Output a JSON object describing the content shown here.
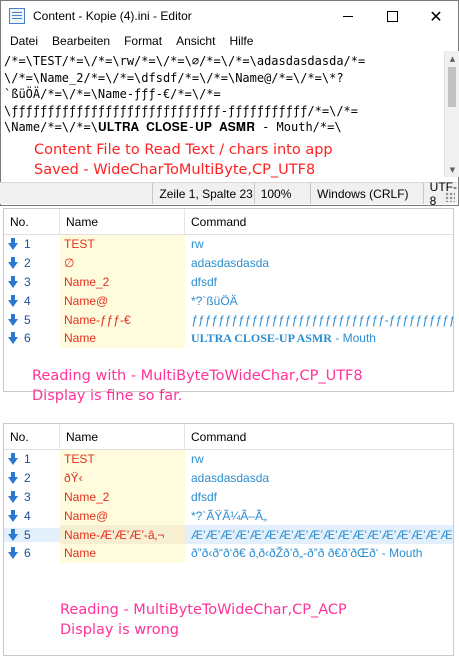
{
  "window": {
    "title": "Content - Kopie (4).ini - Editor",
    "minimize": "",
    "maximize": "",
    "close": "✕"
  },
  "menu": [
    "Datei",
    "Bearbeiten",
    "Format",
    "Ansicht",
    "Hilfe"
  ],
  "editor_lines": [
    "/*=\\TEST/*=\\/*=\\rw/*=\\/*=\\∅/*=\\/*=\\adasdasdasda/*=",
    "\\/*=\\Name_2/*=\\/*=\\dfsdf/*=\\/*=\\Name@/*=\\/*=\\*?",
    "`ßüÖÄ/*=\\/*=\\Name-ƒƒƒ-€/*=\\/*=",
    "\\ƒƒƒƒƒƒƒƒƒƒƒƒƒƒƒƒƒƒƒƒƒƒƒƒƒƒƒƒƒ-ƒƒƒƒƒƒƒƒƒƒƒ/*=\\/*=",
    "\\Name/*=\\/*=\\𝐔𝐋𝐓𝐑𝐀 𝐂𝐋𝐎𝐒𝐄-𝐔𝐏 𝐀𝐒𝐌𝐑 - Mouth/*=\\"
  ],
  "status": {
    "position": "Zeile 1, Spalte 23",
    "zoom": "100%",
    "line_ending": "Windows (CRLF)",
    "encoding": "UTF-8"
  },
  "annotations": {
    "a1_line1": "Content File to Read Text / chars into app",
    "a1_line2": "Saved - WideCharToMultiByte,CP_UTF8",
    "a2_line1": "Reading with - MultiByteToWideChar,CP_UTF8",
    "a2_line2": "Display is fine so far.",
    "a3_line1": "Reading - MultiByteToWideChar,CP_ACP",
    "a3_line2": "Display is wrong"
  },
  "columns": {
    "no": "No.",
    "name": "Name",
    "command": "Command"
  },
  "list_utf8": [
    {
      "no": "1",
      "name": "TEST",
      "command": "rw"
    },
    {
      "no": "2",
      "name": "∅",
      "command": "adasdasdasda"
    },
    {
      "no": "3",
      "name": "Name_2",
      "command": "dfsdf"
    },
    {
      "no": "4",
      "name": "Name@",
      "command": "*?`ßüÖÄ"
    },
    {
      "no": "5",
      "name": "Name-ƒƒƒ-€",
      "command": "ƒƒƒƒƒƒƒƒƒƒƒƒƒƒƒƒƒƒƒƒƒƒƒƒƒƒƒƒƒ-ƒƒƒƒƒƒƒƒƒƒƒ"
    },
    {
      "no": "6",
      "name": "Name",
      "command_bold": "ULTRA CLOSE-UP ASMR",
      "command_rest": " - Mouth"
    }
  ],
  "list_acp": [
    {
      "no": "1",
      "name": "TEST",
      "command": "rw"
    },
    {
      "no": "2",
      "name": "ðŸ‹",
      "command": "adasdasdasda"
    },
    {
      "no": "3",
      "name": "Name_2",
      "command": "dfsdf"
    },
    {
      "no": "4",
      "name": "Name@",
      "command": "*?`ÃŸÃ¼Ã–Ã„"
    },
    {
      "no": "5",
      "name": "Name-Æ’Æ’Æ’-â‚¬",
      "command": "Æ’Æ’Æ’Æ’Æ’Æ’Æ’Æ’Æ’Æ’Æ’Æ’Æ’Æ’Æ’Æ’Æ’Æ’Æ’Æ’Æ’Æ’Æ’Æ’Æ’Æ’Æ’Æ’Æ’-Æ’Æ’Æ’Æ’Æ’Æ’Æ’Æ’Æ’Æ’Æ’"
    },
    {
      "no": "6",
      "name": "Name",
      "command": "ð”ð‹ð“ð‘ð€ ð‚ð‹ðŽð’ð„-ð”ð ð€ð’ðŒð‘ - Mouth"
    }
  ]
}
